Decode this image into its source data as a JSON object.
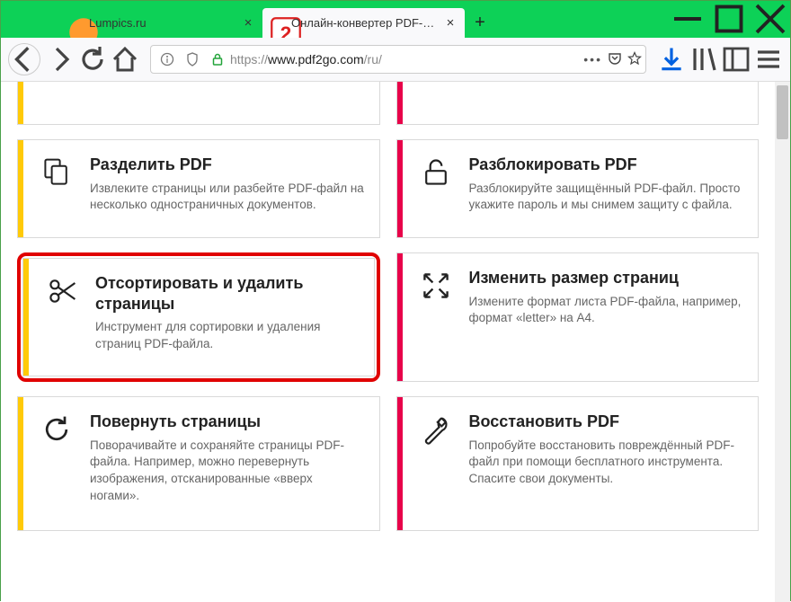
{
  "tabs": [
    {
      "title": "Lumpics.ru",
      "favicon": "orange"
    },
    {
      "title": "Онлайн-конвертер PDF-файл",
      "favicon": "pdf2go"
    }
  ],
  "url": {
    "protocol": "https://",
    "domain": "www.pdf2go.com",
    "path": "/ru/"
  },
  "cards": {
    "split": {
      "title": "Разделить PDF",
      "desc": "Извлеките страницы или разбейте PDF-файл на несколько одностраничных документов."
    },
    "unlock": {
      "title": "Разблокировать PDF",
      "desc": "Разблокируйте защищённый PDF-файл. Просто укажите пароль и мы снимем защиту с файла."
    },
    "sort": {
      "title": "Отсортировать и удалить страницы",
      "desc": "Инструмент для сортировки и удаления страниц PDF-файла."
    },
    "resize": {
      "title": "Изменить размер страниц",
      "desc": "Измените формат листа PDF-файла, например, формат «letter» на A4."
    },
    "rotate": {
      "title": "Повернуть страницы",
      "desc": "Поворачивайте и сохраняйте страницы PDF-файла. Например, можно перевернуть изображения, отсканированные «вверх ногами»."
    },
    "repair": {
      "title": "Восстановить PDF",
      "desc": "Попробуйте восстановить повреждённый PDF-файл при помощи бесплатного инструмента. Спасите свои документы."
    }
  }
}
